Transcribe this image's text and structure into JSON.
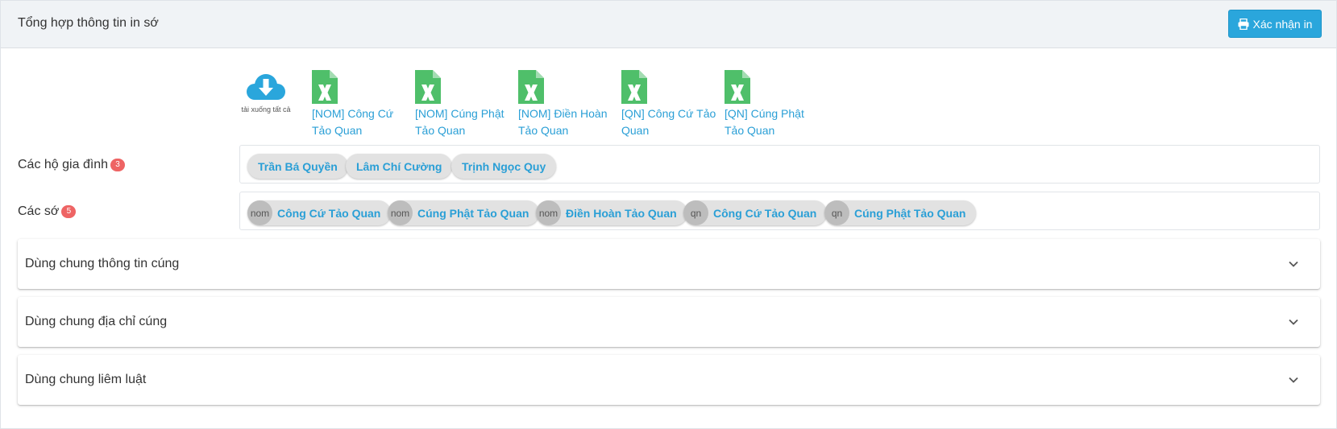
{
  "header": {
    "title": "Tổng hợp thông tin in sớ",
    "print_button_label": "Xác nhận in",
    "print_icon": "printer-icon"
  },
  "downloads": {
    "all_label": "tải xuống tất cả",
    "all_icon": "cloud-download-icon",
    "file_icon": "excel-file-icon",
    "files": [
      {
        "label": "[NOM] Công Cứ Tảo Quan"
      },
      {
        "label": "[NOM] Cúng Phật Tảo Quan"
      },
      {
        "label": "[NOM] Điền Hoàn Tảo Quan"
      },
      {
        "label": "[QN] Công Cứ Tảo Quan"
      },
      {
        "label": "[QN] Cúng Phật Tảo Quan"
      }
    ]
  },
  "households": {
    "label": "Các hộ gia đình",
    "count": "3",
    "items": [
      "Trần Bá Quyền",
      "Lâm Chí Cường",
      "Trịnh Ngọc Quy"
    ]
  },
  "documents": {
    "label": "Các sớ",
    "count": "5",
    "items": [
      {
        "prefix": "nom",
        "label": "Công Cứ Tảo Quan"
      },
      {
        "prefix": "nom",
        "label": "Cúng Phật Tảo Quan"
      },
      {
        "prefix": "nom",
        "label": "Điền Hoàn Tảo Quan"
      },
      {
        "prefix": "qn",
        "label": "Công Cứ Tảo Quan"
      },
      {
        "prefix": "qn",
        "label": "Cúng Phật Tảo Quan"
      }
    ]
  },
  "accordions": [
    {
      "title": "Dùng chung thông tin cúng"
    },
    {
      "title": "Dùng chung địa chỉ cúng"
    },
    {
      "title": "Dùng chung liêm luật"
    }
  ],
  "colors": {
    "accent": "#2aa6dc",
    "link": "#2a9fd6",
    "badge": "#ee6464",
    "excel": "#4fbf6a"
  }
}
